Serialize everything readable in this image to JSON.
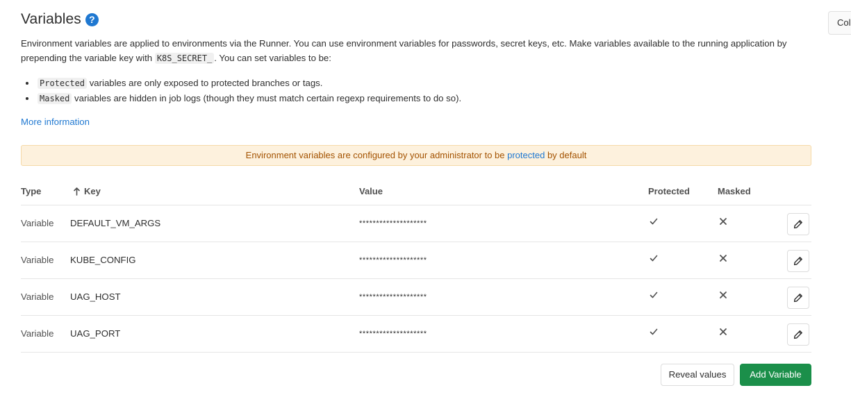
{
  "header": {
    "title": "Variables",
    "help_icon": "?",
    "collapse_label": "Collapse"
  },
  "intro": {
    "line1_before": "Environment variables are applied to environments via the Runner. You can use environment variables for passwords, secret keys, etc. Make variables available to the running application by prepending the variable key with ",
    "prefix_code": "K8S_SECRET_",
    "line1_after": ". You can set variables to be:"
  },
  "bullets": [
    {
      "code": "Protected",
      "text": " variables are only exposed to protected branches or tags."
    },
    {
      "code": "Masked",
      "text": " variables are hidden in job logs (though they must match certain regexp requirements to do so)."
    }
  ],
  "more_link": "More information",
  "alert": {
    "before": "Environment variables are configured by your administrator to be ",
    "link": "protected",
    "after": " by default",
    "color": "#a35200"
  },
  "table": {
    "headers": {
      "type": "Type",
      "key": "Key",
      "key_sort_icon": "arrow-up-icon",
      "value": "Value",
      "protected": "Protected",
      "masked": "Masked"
    },
    "rows": [
      {
        "type": "Variable",
        "key": "DEFAULT_VM_ARGS",
        "value": "********************",
        "protected": "check-icon",
        "masked": "close-icon"
      },
      {
        "type": "Variable",
        "key": "KUBE_CONFIG",
        "value": "********************",
        "protected": "check-icon",
        "masked": "close-icon"
      },
      {
        "type": "Variable",
        "key": "UAG_HOST",
        "value": "********************",
        "protected": "check-icon",
        "masked": "close-icon"
      },
      {
        "type": "Variable",
        "key": "UAG_PORT",
        "value": "********************",
        "protected": "check-icon",
        "masked": "close-icon"
      }
    ]
  },
  "actions": {
    "reveal_label": "Reveal values",
    "add_label": "Add Variable",
    "add_color": "#1b8f4a"
  }
}
